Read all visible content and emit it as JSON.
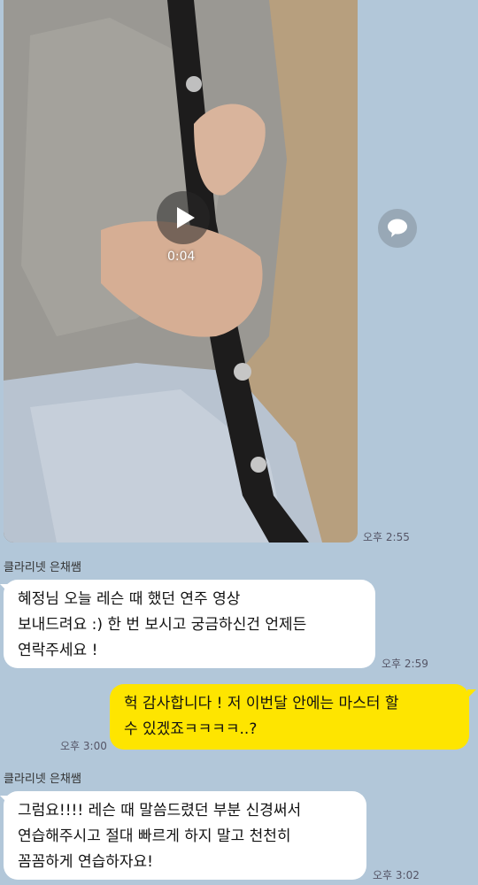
{
  "video": {
    "duration": "0:04",
    "time": "오후 2:55"
  },
  "messages": [
    {
      "sender": "클라리넷 은채쌤",
      "text": "혜정님 오늘 레슨 때 했던 연주 영상\n보내드려요 :) 한 번 보시고 궁금하신건 언제든\n연락주세요 !",
      "time": "오후 2:59"
    },
    {
      "text": "헉 감사합니다 ! 저 이번달 안에는 마스터 할\n수 있겠죠ㅋㅋㅋㅋ..?",
      "time": "오후 3:00"
    },
    {
      "sender": "클라리넷 은채쌤",
      "text": "그럼요!!!! 레슨 때 말씀드렸던 부분 신경써서\n연습해주시고 절대 빠르게 하지 말고 천천히\n꼼꼼하게 연습하자요!",
      "time": "오후 3:02"
    }
  ]
}
